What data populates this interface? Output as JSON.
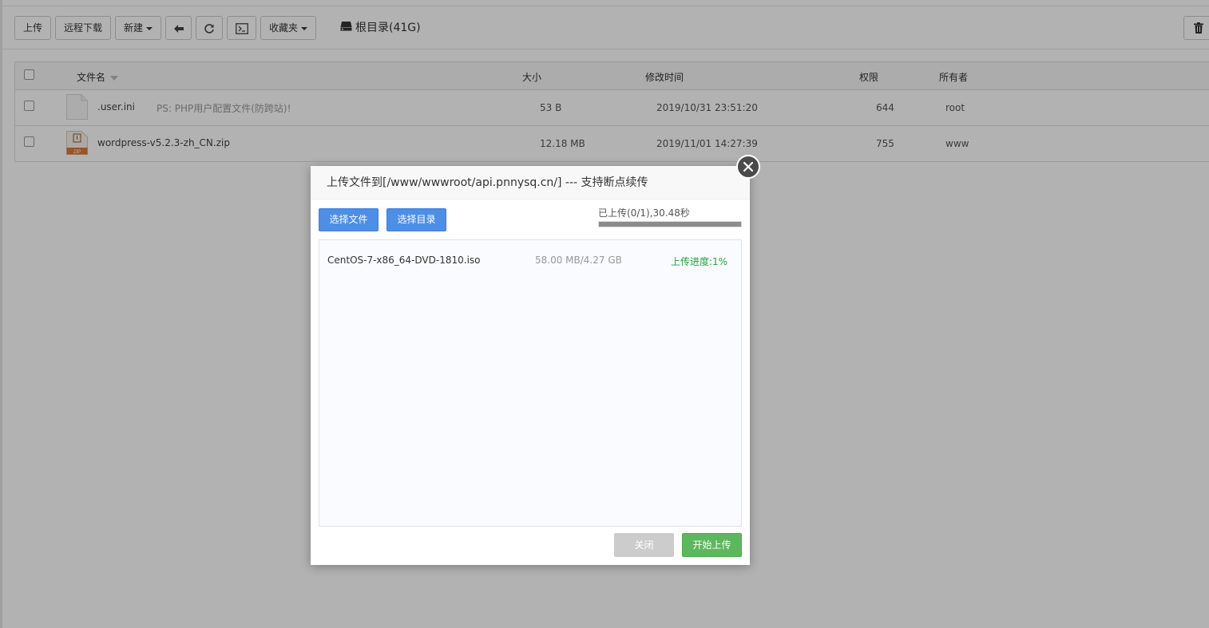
{
  "toolbar": {
    "upload_label": "上传",
    "remote_download_label": "远程下载",
    "new_label": "新建",
    "favorites_label": "收藏夹",
    "root_dir_label": "根目录(41G)"
  },
  "table": {
    "headers": {
      "filename": "文件名",
      "size": "大小",
      "modified": "修改时间",
      "permission": "权限",
      "owner": "所有者"
    },
    "rows": [
      {
        "name": ".user.ini",
        "note": "PS: PHP用户配置文件(防跨站)!",
        "size": "53 B",
        "modified": "2019/10/31 23:51:20",
        "permission": "644",
        "owner": "root",
        "icon": "file-icon"
      },
      {
        "name": "wordpress-v5.2.3-zh_CN.zip",
        "size": "12.18 MB",
        "modified": "2019/11/01 14:27:39",
        "permission": "755",
        "owner": "www",
        "icon": "zip-file-icon"
      }
    ]
  },
  "modal": {
    "title": "上传文件到[/www/wwwroot/api.pnnysq.cn/] --- 支持断点续传",
    "choose_file_label": "选择文件",
    "choose_dir_label": "选择目录",
    "upload_status": "已上传(0/1),30.48秒",
    "overall_progress": 1.0,
    "files": [
      {
        "name": "CentOS-7-x86_64-DVD-1810.iso",
        "size": "58.00 MB/4.27 GB",
        "progress_text": "上传进度:1%"
      }
    ],
    "close_label": "关闭",
    "start_upload_label": "开始上传"
  },
  "colors": {
    "primary_blue": "#4c8ee8",
    "success_green": "#5cb85c",
    "progress_text_green": "#20a53a",
    "zip_orange": "#e0773a"
  }
}
